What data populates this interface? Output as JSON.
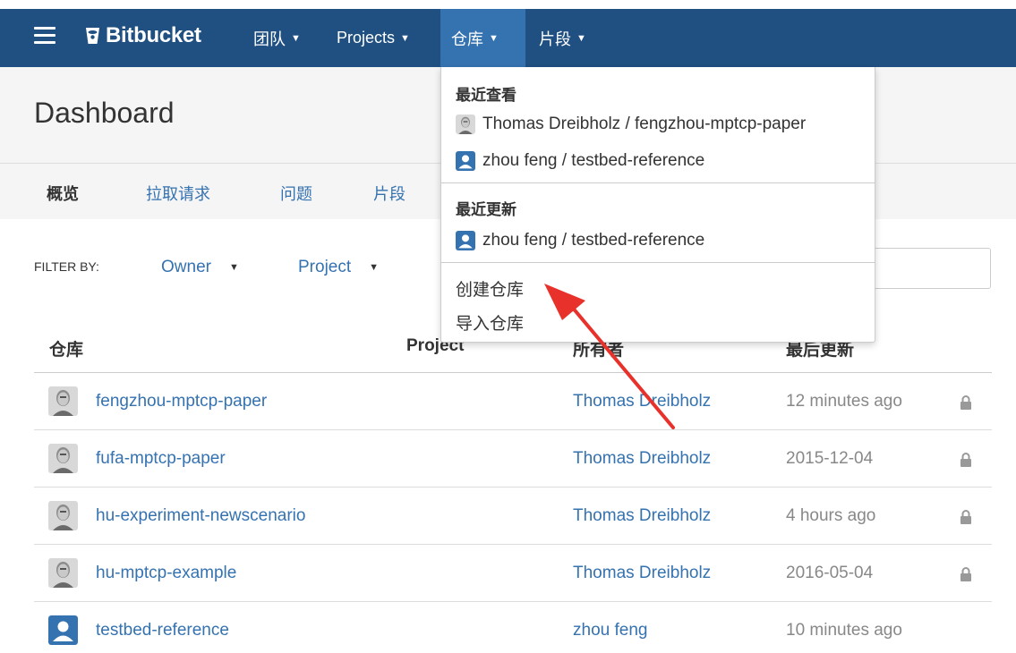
{
  "nav": {
    "logo": "Bitbucket",
    "items": [
      {
        "label": "团队"
      },
      {
        "label": "Projects"
      },
      {
        "label": "仓库"
      },
      {
        "label": "片段"
      }
    ]
  },
  "header": {
    "title": "Dashboard",
    "tabs": [
      {
        "label": "概览"
      },
      {
        "label": "拉取请求"
      },
      {
        "label": "问题"
      },
      {
        "label": "片段"
      }
    ]
  },
  "filter": {
    "label": "FILTER BY:",
    "owner": "Owner",
    "project": "Project",
    "search_placeholder": ""
  },
  "table": {
    "columns": [
      "仓库",
      "Project",
      "所有者",
      "最后更新"
    ],
    "rows": [
      {
        "repo": "fengzhou-mptcp-paper",
        "owner": "Thomas Dreibholz",
        "updated": "12 minutes ago",
        "avatar": "photo-avatar",
        "private": true
      },
      {
        "repo": "fufa-mptcp-paper",
        "owner": "Thomas Dreibholz",
        "updated": "2015-12-04",
        "avatar": "photo-avatar",
        "private": true
      },
      {
        "repo": "hu-experiment-newscenario",
        "owner": "Thomas Dreibholz",
        "updated": "4 hours ago",
        "avatar": "photo-avatar",
        "private": true
      },
      {
        "repo": "hu-mptcp-example",
        "owner": "Thomas Dreibholz",
        "updated": "2016-05-04",
        "avatar": "photo-avatar",
        "private": true
      },
      {
        "repo": "testbed-reference",
        "owner": "zhou feng",
        "updated": "10 minutes ago",
        "avatar": "user-avatar",
        "private": false
      }
    ]
  },
  "dropdown": {
    "recent_viewed_title": "最近查看",
    "recent_viewed": [
      {
        "label": "Thomas Dreibholz / fengzhou-mptcp-paper",
        "avatar": "photo-avatar"
      },
      {
        "label": "zhou feng / testbed-reference",
        "avatar": "user-avatar"
      }
    ],
    "recent_updated_title": "最近更新",
    "recent_updated": [
      {
        "label": "zhou feng / testbed-reference",
        "avatar": "user-avatar"
      }
    ],
    "create": "创建仓库",
    "import": "导入仓库"
  },
  "colors": {
    "nav_bg": "#205081",
    "nav_active": "#3572b0",
    "link": "#3572b0",
    "arrow": "#e8312a"
  }
}
